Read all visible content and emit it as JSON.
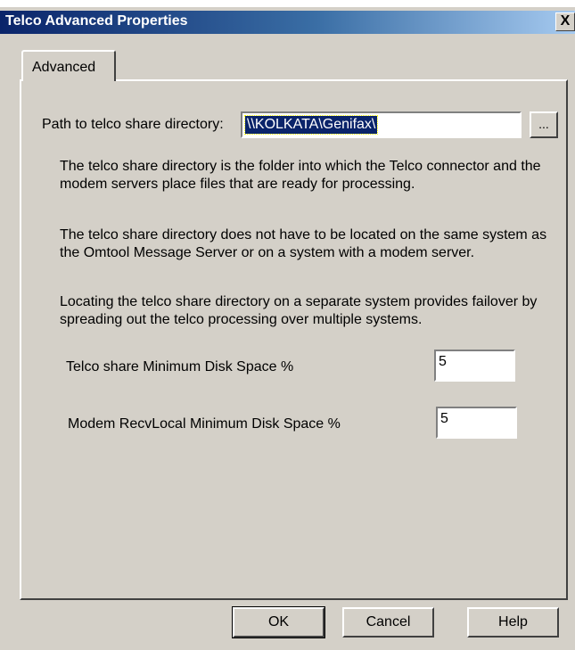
{
  "window": {
    "title": "Telco Advanced Properties",
    "close_label": "X"
  },
  "tabs": [
    {
      "label": "Advanced"
    }
  ],
  "path": {
    "label": "Path to telco share directory:",
    "value": "\\\\KOLKATA\\Genifax\\",
    "browse_label": "..."
  },
  "descriptions": [
    "The telco share directory is the folder into which the Telco connector and the modem servers place files that are ready for processing.",
    "The telco share directory does not have to be located on the same system as the Omtool Message Server or on a system with a modem server.",
    "Locating the telco share directory on a separate system provides failover by spreading out the telco processing over multiple systems."
  ],
  "telco_min": {
    "label": "Telco share Minimum Disk Space %",
    "value": "5"
  },
  "modem_min": {
    "label": "Modem RecvLocal Minimum Disk Space %",
    "value": "5"
  },
  "buttons": {
    "ok": "OK",
    "cancel": "Cancel",
    "help": "Help"
  }
}
